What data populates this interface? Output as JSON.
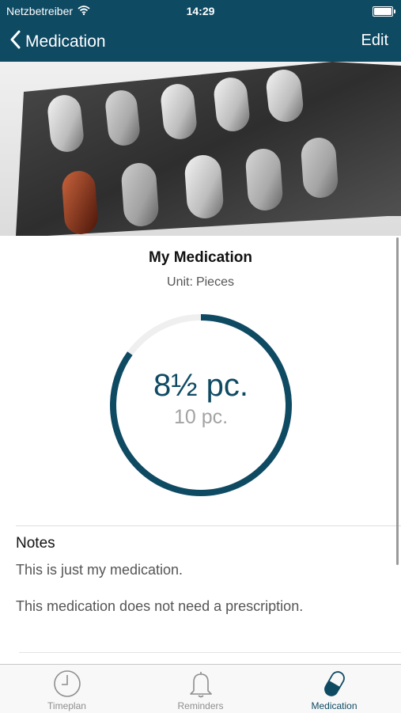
{
  "status_bar": {
    "carrier": "Netzbetreiber",
    "time": "14:29"
  },
  "nav": {
    "back_label": "Medication",
    "edit_label": "Edit"
  },
  "medication": {
    "name": "My Medication",
    "unit_label": "Unit:",
    "unit_value": "Pieces",
    "current_display": "8½ pc.",
    "total_display": "10 pc.",
    "remaining_fraction": 0.85
  },
  "notes": {
    "heading": "Notes",
    "paragraphs": [
      "This is just my medication.",
      "This medication does not need a prescription."
    ]
  },
  "tabs": [
    {
      "label": "Timeplan",
      "icon": "clock-icon",
      "active": false
    },
    {
      "label": "Reminders",
      "icon": "bell-icon",
      "active": false
    },
    {
      "label": "Medication",
      "icon": "pill-icon",
      "active": true
    }
  ],
  "colors": {
    "accent": "#0f4a63",
    "ring_track": "#efefef",
    "tab_inactive": "#8e8e8e"
  }
}
